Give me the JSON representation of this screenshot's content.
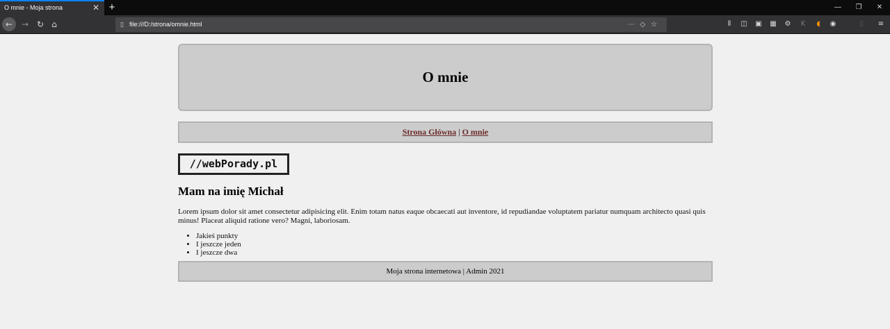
{
  "browser": {
    "tab_title": "O mnie - Moja strona",
    "tab_close": "✕",
    "new_tab": "+",
    "url": "file:///D:/strona/omnie.html",
    "window_controls": [
      "—",
      "❐",
      "✕"
    ]
  },
  "page": {
    "header_title": "O mnie",
    "menu": {
      "link_home": "Strona Główna",
      "separator": "|",
      "link_about": "O mnie"
    },
    "logo_text": "//webPorady.pl",
    "heading": "Mam na imię Michał",
    "paragraph": "Lorem ipsum dolor sit amet consectetur adipisicing elit. Enim totam natus eaque obcaecati aut inventore, id repudiandae voluptatem pariatur numquam architecto quasi quis minus! Placeat aliquid ratione vero? Magni, laboriosam.",
    "list": [
      "Jakieś punkty",
      "I jeszcze jeden",
      "I jeszcze dwa"
    ],
    "footer": "Moja strona internetowa | Admin 2021"
  }
}
